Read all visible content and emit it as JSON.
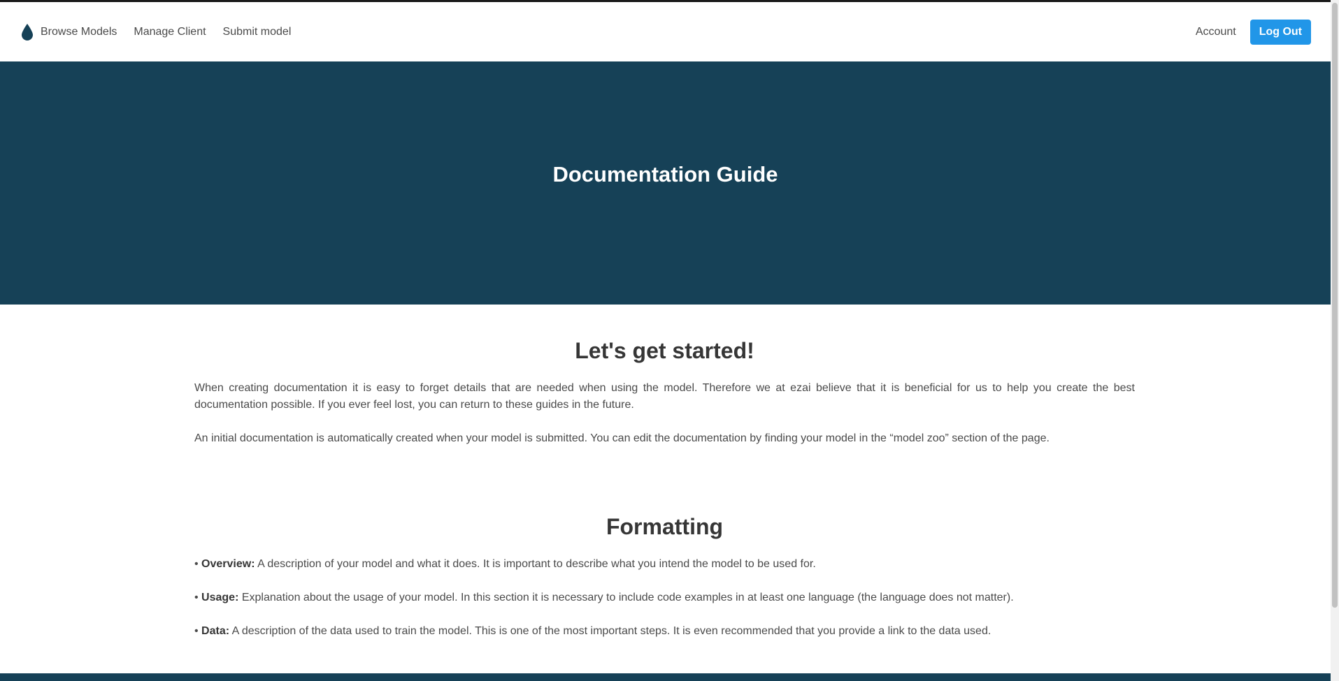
{
  "navbar": {
    "logo_icon": "water-drop-icon",
    "links": [
      "Browse Models",
      "Manage Client",
      "Submit model"
    ],
    "account_label": "Account",
    "logout_label": "Log Out"
  },
  "hero": {
    "title": "Documentation Guide"
  },
  "intro": {
    "title": "Let's get started!",
    "paragraphs": [
      "When creating documentation it is easy to forget details that are needed when using the model. Therefore we at ezai believe that it is beneficial for us to help you create the best documentation possible. If you ever feel lost, you can return to these guides in the future.",
      "An initial documentation is automatically created when your model is submitted. You can edit the documentation by finding your model in the “model zoo” section of the page."
    ]
  },
  "formatting": {
    "title": "Formatting",
    "items": [
      {
        "term": "Overview:",
        "text": " A description of your model and what it does. It is important to describe what you intend the model to be used for."
      },
      {
        "term": "Usage:",
        "text": " Explanation about the usage of your model. In this section it is necessary to include code examples in at least one language (the language does not matter)."
      },
      {
        "term": "Data:",
        "text": " A description of the data used to train the model. This is one of the most important steps. It is even recommended that you provide a link to the data used."
      }
    ]
  },
  "colors": {
    "hero_bg": "#164157",
    "button_bg": "#2196e8"
  }
}
